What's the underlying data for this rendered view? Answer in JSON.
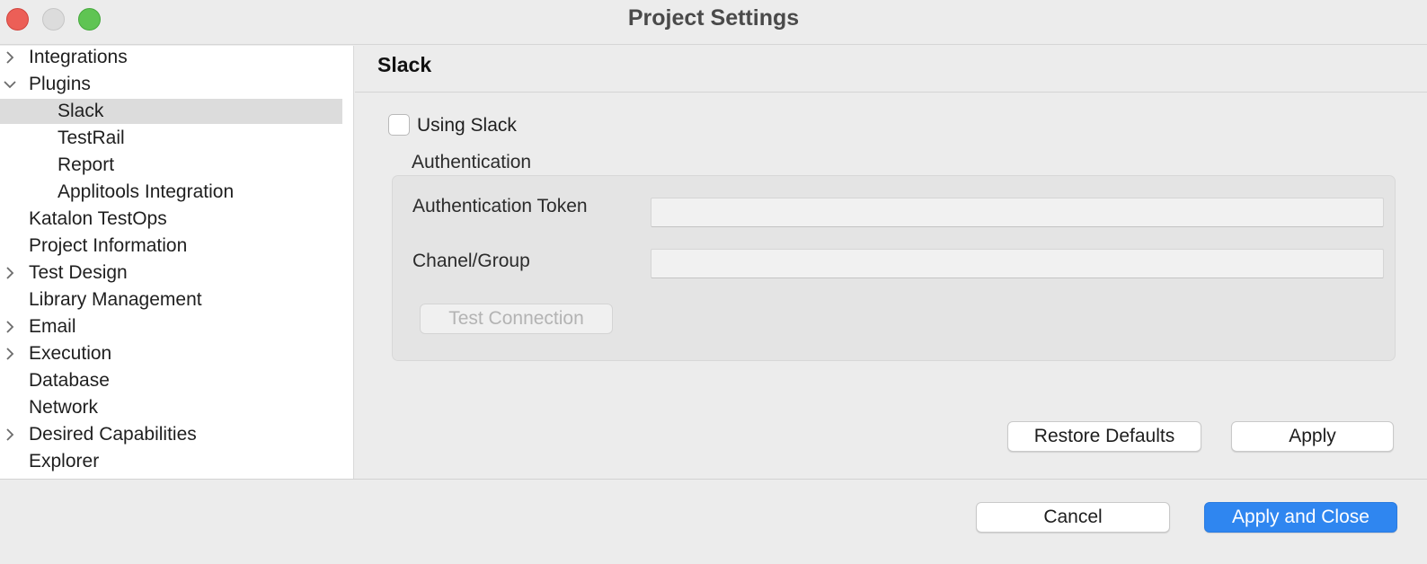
{
  "window": {
    "title": "Project Settings"
  },
  "tree": {
    "items": [
      {
        "label": "Integrations",
        "expander": "collapsed"
      },
      {
        "label": "Plugins",
        "expander": "expanded"
      },
      {
        "label": "Slack",
        "expander": "none",
        "selected": true
      },
      {
        "label": "TestRail",
        "expander": "none"
      },
      {
        "label": "Report",
        "expander": "none"
      },
      {
        "label": "Applitools Integration",
        "expander": "none"
      },
      {
        "label": "Katalon TestOps",
        "expander": "none"
      },
      {
        "label": "Project Information",
        "expander": "none"
      },
      {
        "label": "Test Design",
        "expander": "collapsed"
      },
      {
        "label": "Library Management",
        "expander": "none"
      },
      {
        "label": "Email",
        "expander": "collapsed"
      },
      {
        "label": "Execution",
        "expander": "collapsed"
      },
      {
        "label": "Database",
        "expander": "none"
      },
      {
        "label": "Network",
        "expander": "none"
      },
      {
        "label": "Desired Capabilities",
        "expander": "collapsed"
      },
      {
        "label": "Explorer",
        "expander": "none"
      }
    ]
  },
  "panel": {
    "title": "Slack",
    "using_slack": {
      "label": "Using Slack",
      "checked": false
    },
    "group_label": "Authentication",
    "auth_token": {
      "label": "Authentication Token",
      "value": ""
    },
    "channel": {
      "label": "Chanel/Group",
      "value": ""
    },
    "test_connection": "Test Connection",
    "restore_defaults": "Restore Defaults",
    "apply": "Apply"
  },
  "footer": {
    "cancel": "Cancel",
    "apply_close": "Apply and Close"
  },
  "colors": {
    "accent": "#2f86f0",
    "close": "#ec5f57",
    "maximize": "#5fc453"
  }
}
